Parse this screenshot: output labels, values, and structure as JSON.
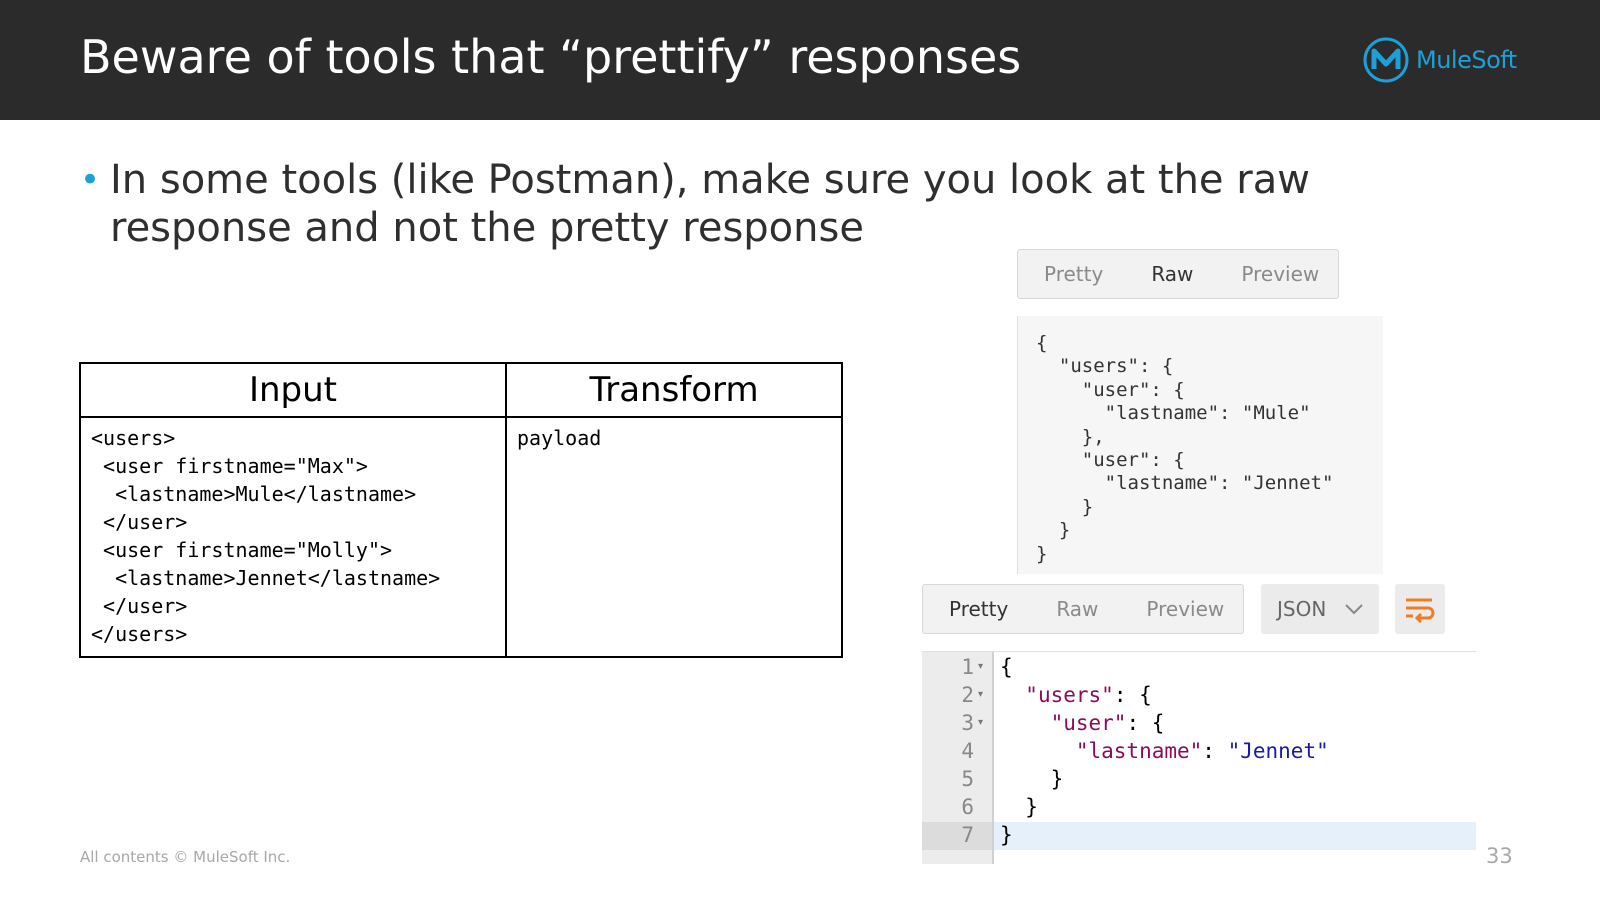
{
  "slide": {
    "title": "Beware of tools that “prettify” responses",
    "logo_text": "MuleSoft",
    "bullet": "In some tools (like Postman), make sure you look at the raw response and not the pretty response",
    "footer": "All contents © MuleSoft Inc.",
    "page_number": "33"
  },
  "table": {
    "headers": [
      "Input",
      "Transform"
    ],
    "input_code": "<users>\n <user firstname=\"Max\">\n  <lastname>Mule</lastname>\n </user>\n <user firstname=\"Molly\">\n  <lastname>Jennet</lastname>\n </user>\n</users>",
    "transform_code": "payload"
  },
  "raw_view": {
    "tabs": [
      "Pretty",
      "Raw",
      "Preview"
    ],
    "active_tab": "Raw",
    "content": "{\n  \"users\": {\n    \"user\": {\n      \"lastname\": \"Mule\"\n    },\n    \"user\": {\n      \"lastname\": \"Jennet\"\n    }\n  }\n}"
  },
  "pretty_view": {
    "tabs": [
      "Pretty",
      "Raw",
      "Preview"
    ],
    "active_tab": "Pretty",
    "format": "JSON",
    "line_numbers": [
      "1",
      "2",
      "3",
      "4",
      "5",
      "6",
      "7"
    ],
    "lines": [
      {
        "indent": "",
        "key": "",
        "sep": "",
        "value": "",
        "punct": "{"
      },
      {
        "indent": "  ",
        "key": "\"users\"",
        "sep": ": ",
        "value": "",
        "punct": "{"
      },
      {
        "indent": "    ",
        "key": "\"user\"",
        "sep": ": ",
        "value": "",
        "punct": "{"
      },
      {
        "indent": "      ",
        "key": "\"lastname\"",
        "sep": ": ",
        "value": "\"Jennet\"",
        "punct": ""
      },
      {
        "indent": "    ",
        "key": "",
        "sep": "",
        "value": "",
        "punct": "}"
      },
      {
        "indent": "  ",
        "key": "",
        "sep": "",
        "value": "",
        "punct": "}"
      },
      {
        "indent": "",
        "key": "",
        "sep": "",
        "value": "",
        "punct": "}"
      }
    ],
    "colors": {
      "key": "#8b0d5a",
      "string": "#1a1aa6",
      "highlight": "#e6f0fb"
    }
  },
  "colors": {
    "header_bg": "#2b2b2b",
    "accent": "#1ba1d8",
    "wrap_icon": "#f07d23"
  }
}
